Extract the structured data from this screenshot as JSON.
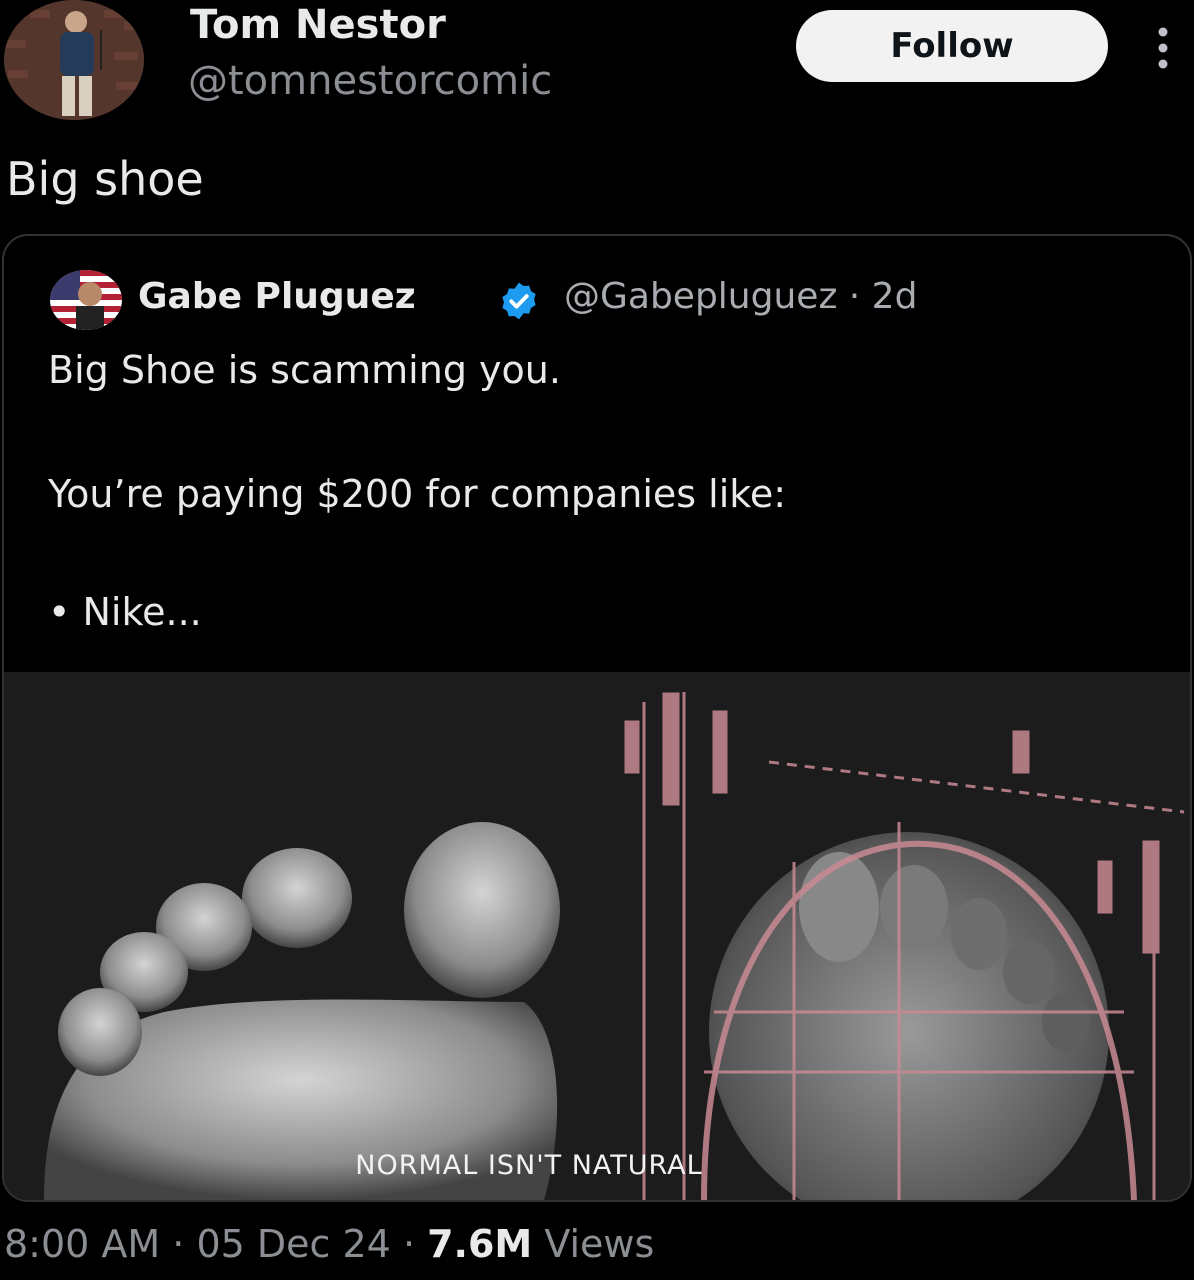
{
  "author": {
    "display_name": "Tom Nestor",
    "handle": "@tomnestorcomic",
    "avatar_icon": "comedian-on-stage-avatar"
  },
  "follow_button_label": "Follow",
  "more_icon": "more-options-vertical-dots",
  "tweet": {
    "text": "Big shoe"
  },
  "quoted_tweet": {
    "display_name": "Gabe Pluguez",
    "verified_icon": "verified-badge",
    "handle_and_age": "@Gabepluguez · 2d",
    "lines": [
      "Big Shoe is scamming you.",
      "You’re paying $200 for companies like:",
      "• Nike..."
    ],
    "media": {
      "caption": "NORMAL ISN'T NATURAL",
      "accent_color": "#c98a94"
    }
  },
  "meta": {
    "time": "8:00 AM",
    "separator": " · ",
    "date": "05 Dec 24",
    "views_count": "7.6M",
    "views_label": " Views"
  }
}
